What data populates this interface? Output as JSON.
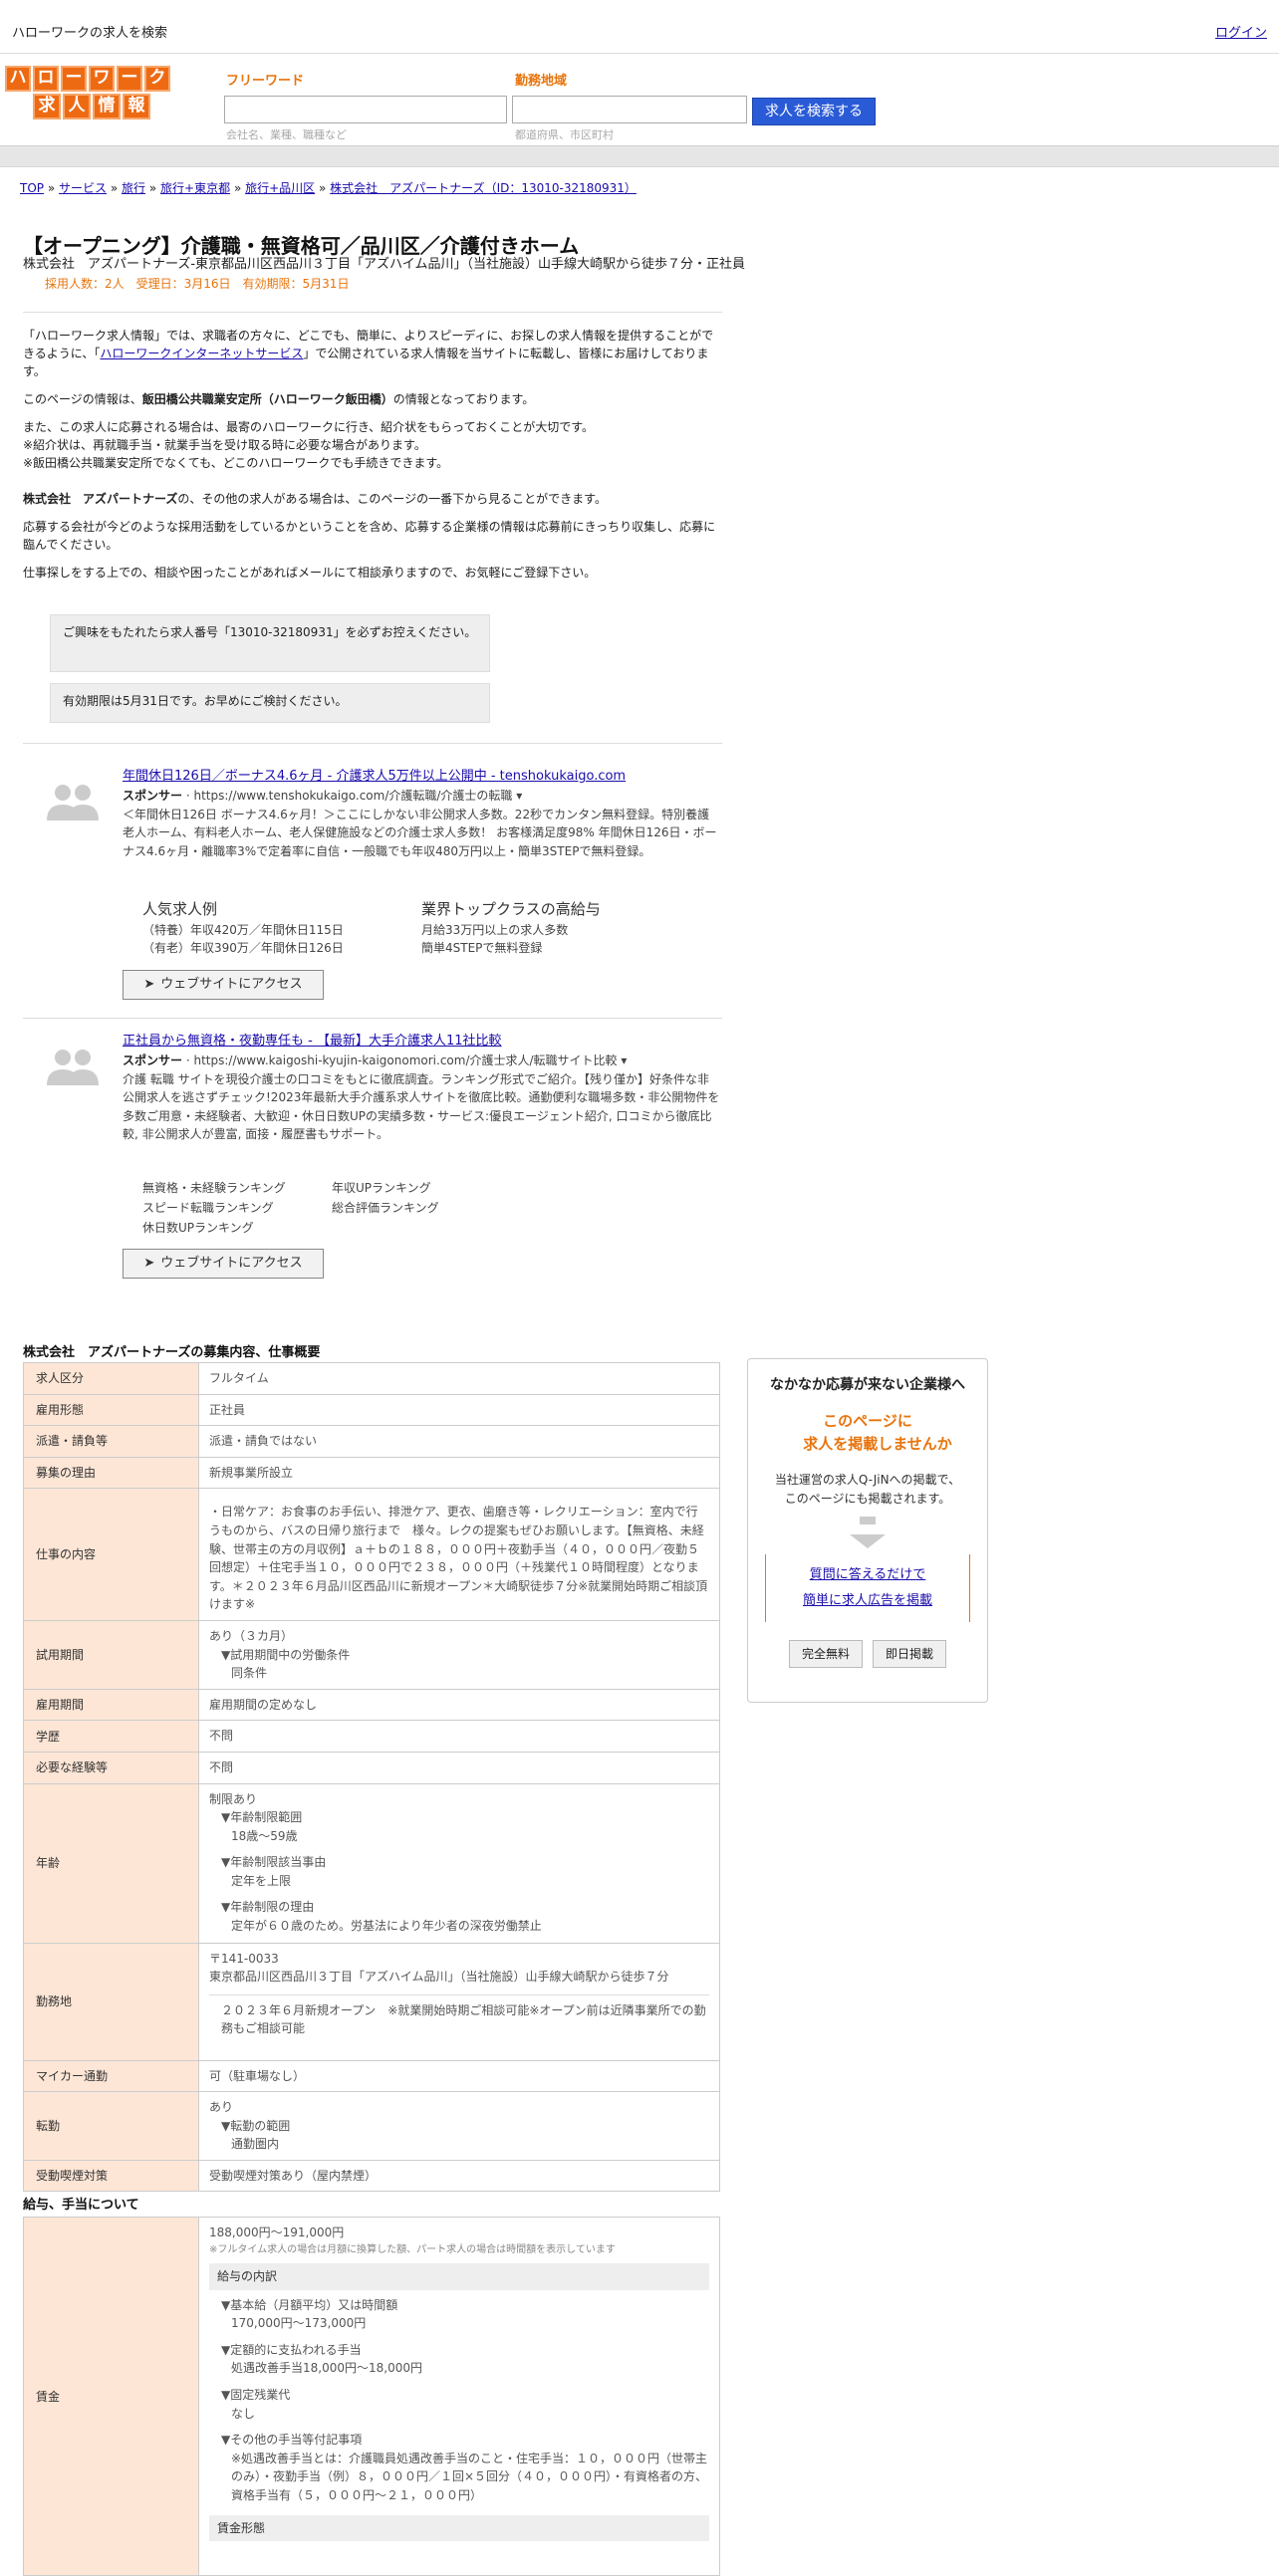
{
  "topbar": {
    "title": "ハローワークの求人を検索",
    "login": "ログイン"
  },
  "logo": {
    "row1": [
      "ハ",
      "ロ",
      "ー",
      "ワ",
      "ー",
      "ク"
    ],
    "row2": [
      "求",
      "人",
      "情",
      "報"
    ]
  },
  "search": {
    "freeword_label": "フリーワード",
    "freeword_placeholder": "会社名、業種、職種など",
    "area_label": "勤務地域",
    "area_placeholder": "都道府県、市区町村",
    "button": "求人を検索する"
  },
  "breadcrumb": [
    "TOP",
    "サービス",
    "旅行",
    "旅行+東京都",
    "旅行+品川区",
    "株式会社　アズパートナーズ（ID：13010-32180931）"
  ],
  "job": {
    "title": "【オープニング】介護職・無資格可／品川区／介護付きホーム",
    "subtitle": "株式会社　アズパートナーズ-東京都品川区西品川３丁目「アズハイム品川」（当社施設）山手線大崎駅から徒歩７分・正社員",
    "meta": "採用人数：2人　受理日：3月16日　有効期限：5月31日"
  },
  "intro": {
    "p1a": "「ハローワーク求人情報」では、求職者の方々に、どこでも、簡単に、よりスピーディに、お探しの求人情報を提供することができるように、「",
    "p1link": "ハローワークインターネットサービス",
    "p1b": "」で公開されている求人情報を当サイトに転載し、皆様にお届けしております。",
    "p2a": "このページの情報は、",
    "p2b": "飯田橋公共職業安定所（ハローワーク飯田橋）",
    "p2c": "の情報となっております。",
    "p3": "また、この求人に応募される場合は、最寄のハローワークに行き、紹介状をもらっておくことが大切です。",
    "p3b": "※紹介状は、再就職手当・就業手当を受け取る時に必要な場合があります。",
    "p3c": "※飯田橋公共職業安定所でなくても、どこのハローワークでも手続きできます。",
    "p4a": "株式会社　アズパートナーズ",
    "p4b": "の、その他の求人がある場合は、このページの一番下から見ることができます。",
    "p5": "応募する会社が今どのような採用活動をしているかということを含め、応募する企業様の情報は応募前にきっちり収集し、応募に臨んでください。",
    "p6": "仕事探しをする上での、相談や困ったことがあればメールにて相談承りますので、お気軽にご登録下さい。"
  },
  "notices": [
    "ご興味をもたれたら求人番号「13010-32180931」を必ずお控えください。",
    "有効期限は5月31日です。お早めにご検討ください。"
  ],
  "ads": [
    {
      "title": "年間休日126日／ボーナス4.6ヶ月 - 介護求人5万件以上公開中 - tenshokukaigo.com",
      "sponsor": "スポンサー",
      "url": "https://www.tenshokukaigo.com/介護転職/介護士の転職",
      "text": "＜年間休日126日 ボーナス4.6ヶ月！＞ここにしかない非公開求人多数。22秒でカンタン無料登録。特別養護老人ホーム、有料老人ホーム、老人保健施設などの介護士求人多数！ お客様満足度98% 年間休日126日・ボーナス4.6ヶ月・離職率3%で定着率に自信・一般職でも年収480万円以上・簡単3STEPで無料登録。",
      "links": [
        {
          "h": "人気求人例",
          "d1": "（特養）年収420万／年間休日115日",
          "d2": "（有老）年収390万／年間休日126日"
        },
        {
          "h": "業界トップクラスの高給与",
          "d1": "月給33万円以上の求人多数",
          "d2": "簡単4STEPで無料登録"
        }
      ],
      "button": "ウェブサイトにアクセス"
    },
    {
      "title": "正社員から無資格・夜勤専任も - 【最新】大手介護求人11社比較",
      "sponsor": "スポンサー",
      "url": "https://www.kaigoshi-kyujin-kaigonomori.com/介護士求人/転職サイト比較",
      "text": "介護 転職 サイトを現役介護士の口コミをもとに徹底調査。ランキング形式でご紹介。【残り僅か】好条件な非公開求人を逃さずチェック!2023年最新大手介護系求人サイトを徹底比較。通勤便利な職場多数・非公開物件を多数ご用意・未経験者、大歓迎・休日日数UPの実績多数・サービス:優良エージェント紹介, 口コミから徹底比較, 非公開求人が豊富, 面接・履歴書もサポート。",
      "links": [
        "無資格・未経験ランキング",
        "年収UPランキング",
        "スピード転職ランキング",
        "総合評価ランキング",
        "休日数UPランキング"
      ],
      "button": "ウェブサイトにアクセス"
    }
  ],
  "section1": "株式会社　アズパートナーズの募集内容、仕事概要",
  "rows": {
    "kyujin_kubun": [
      "求人区分",
      "フルタイム"
    ],
    "koyo_keitai": [
      "雇用形態",
      "正社員"
    ],
    "haken": [
      "派遣・請負等",
      "派遣・請負ではない"
    ],
    "riyu": [
      "募集の理由",
      "新規事業所設立"
    ],
    "shigoto": [
      "仕事の内容",
      "・日常ケア：お食事のお手伝い、排泄ケア、更衣、歯磨き等・レクリエーション：室内で行うものから、バスの日帰り旅行まで　様々。レクの提案もぜひお願いします。【無資格、未経験、世帯主の方の月収例】ａ＋ｂの１８８，０００円＋夜勤手当（４０，０００円／夜勤５回想定）＋住宅手当１０，０００円で２３８，０００円（＋残業代１０時間程度）となります。＊２０２３年６月品川区西品川に新規オープン＊大崎駅徒歩７分※就業開始時期ご相談頂けます※"
    ],
    "shiyo": {
      "label": "試用期間",
      "v1": "あり（３カ月）",
      "v2": "▼試用期間中の労働条件",
      "v3": "同条件"
    },
    "kikan": [
      "雇用期間",
      "雇用期間の定めなし"
    ],
    "gakureki": [
      "学歴",
      "不問"
    ],
    "keiken": [
      "必要な経験等",
      "不問"
    ],
    "nenrei": {
      "label": "年齢",
      "v1": "制限あり",
      "h1": "▼年齢制限範囲",
      "d1": "18歳〜59歳",
      "h2": "▼年齢制限該当事由",
      "d2": "定年を上限",
      "h3": "▼年齢制限の理由",
      "d3": "定年が６０歳のため。労基法により年少者の深夜労働禁止"
    },
    "kinmuchi": {
      "label": "勤務地",
      "zip": "〒141-0033",
      "addr": "東京都品川区西品川３丁目「アズハイム品川」（当社施設）山手線大崎駅から徒歩７分",
      "note": "２０２３年６月新規オープン　※就業開始時期ご相談可能※オープン前は近隣事業所での勤務もご相談可能"
    },
    "mycar": [
      "マイカー通勤",
      "可（駐車場なし）"
    ],
    "tenkin": {
      "label": "転勤",
      "v1": "あり",
      "v2": "▼転勤の範囲",
      "v3": "通勤圏内"
    },
    "judo": [
      "受動喫煙対策",
      "受動喫煙対策あり（屋内禁煙）"
    ]
  },
  "section2": "給与、手当について",
  "salary": {
    "label": "賃金",
    "range": "188,000円〜191,000円",
    "note": "※フルタイム求人の場合は月額に換算した額、パート求人の場合は時間額を表示しています",
    "breakdown_h": "給与の内訳",
    "b1h": "▼基本給（月額平均）又は時間額",
    "b1": "170,000円〜173,000円",
    "b2h": "▼定額的に支払われる手当",
    "b2": "処遇改善手当18,000円〜18,000円",
    "b3h": "▼固定残業代",
    "b3": "なし",
    "b4h": "▼その他の手当等付記事項",
    "b4": "※処遇改善手当とは：介護職員処遇改善手当のこと・住宅手当：１０，０００円（世帯主のみ）・夜勤手当（例）８，０００円／１回×５回分（４０，０００円）・有資格者の方、資格手当有（５，０００円〜２１，０００円）",
    "form_h": "賃金形態"
  },
  "side": {
    "heading": "なかなか応募が来ない企業様へ",
    "catch1": "このページに",
    "catch2": "求人を掲載しませんか",
    "text1": "当社運営の求人Q-JiNへの掲載で、",
    "text2": "このページにも掲載されます。",
    "link1": "質問に答えるだけで",
    "link2": "簡単に求人広告を掲載",
    "btn1": "完全無料",
    "btn2": "即日掲載"
  },
  "colors": {
    "accent": "#e8740c",
    "link": "#1a0dab",
    "th_bg": "#fde6d6",
    "button": "#2a5bd7"
  }
}
